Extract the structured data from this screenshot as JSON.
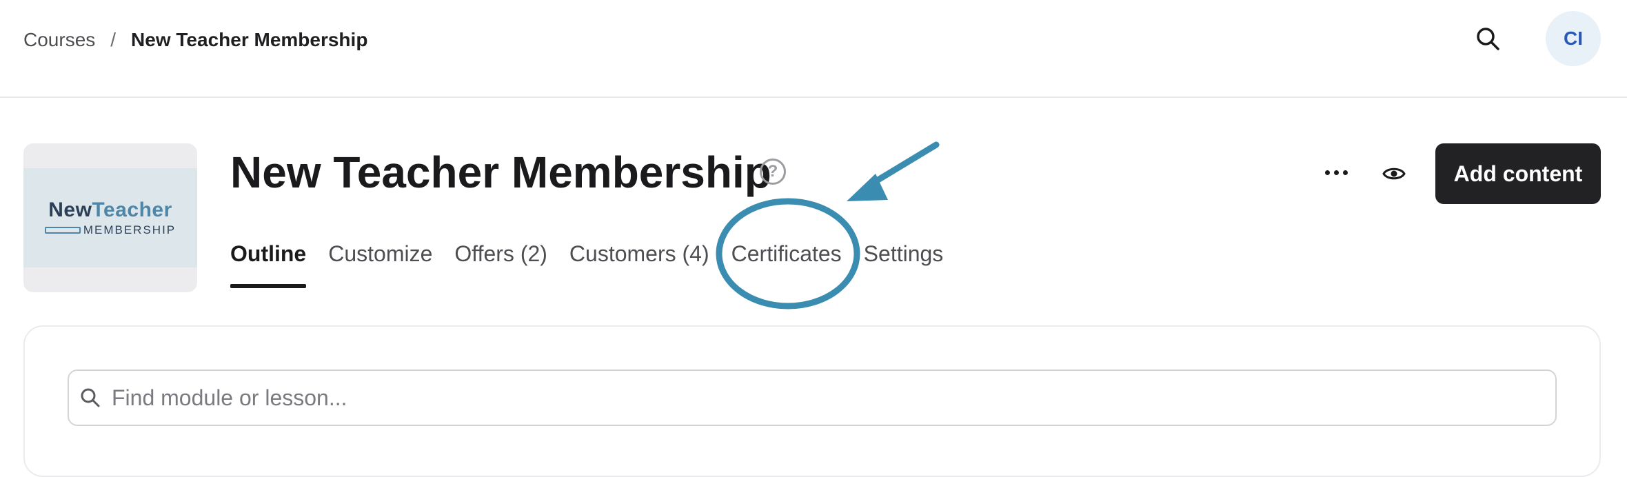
{
  "breadcrumb": {
    "parent": "Courses",
    "separator": "/",
    "current": "New Teacher Membership"
  },
  "header": {
    "avatar_initials": "CI"
  },
  "course": {
    "title": "New Teacher Membership",
    "help_symbol": "?",
    "thumbnail": {
      "line1_a": "New",
      "line1_b": "Teacher",
      "line2": "MEMBERSHIP"
    }
  },
  "tabs": [
    {
      "label": "Outline",
      "active": true
    },
    {
      "label": "Customize",
      "active": false
    },
    {
      "label": "Offers (2)",
      "active": false
    },
    {
      "label": "Customers (4)",
      "active": false
    },
    {
      "label": "Certificates",
      "active": false
    },
    {
      "label": "Settings",
      "active": false
    }
  ],
  "actions": {
    "add_content_label": "Add content"
  },
  "search": {
    "placeholder": "Find module or lesson...",
    "value": ""
  },
  "colors": {
    "annotation": "#3a8cb0",
    "primary_button": "#222224",
    "avatar_bg": "#e8f0f8",
    "avatar_text": "#2a59b3"
  },
  "icons": {
    "search": "search-icon",
    "help": "help-circle-icon",
    "more": "more-horizontal-icon",
    "preview": "eye-icon"
  }
}
